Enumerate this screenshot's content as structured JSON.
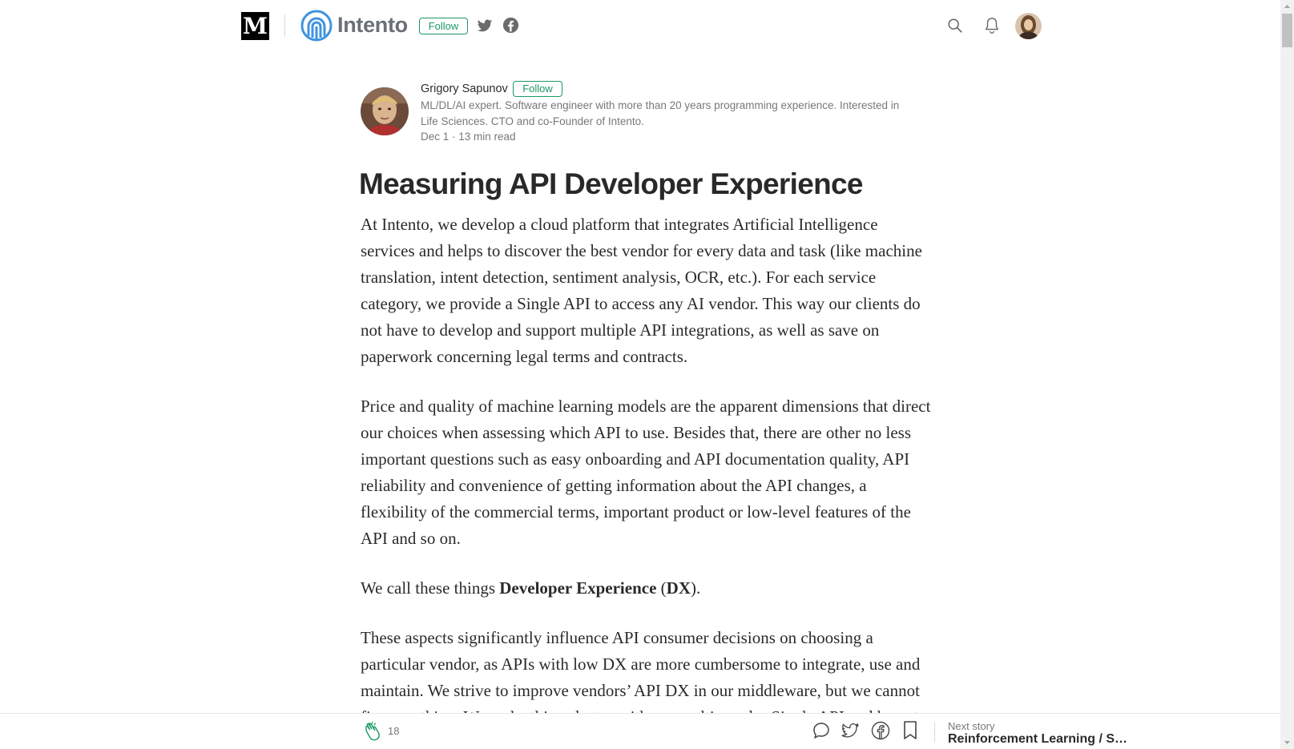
{
  "header": {
    "site_logo": "M",
    "publication_name": "Intento",
    "follow_label": "Follow"
  },
  "author": {
    "name": "Grigory Sapunov",
    "follow_label": "Follow",
    "bio": "ML/DL/AI expert. Software engineer with more than 20 years programming experience. Interested in Life Sciences. CTO and co-Founder of Intento.",
    "meta": "Dec 1 · 13 min read"
  },
  "article": {
    "title": "Measuring API Developer Experience",
    "p1": "At Intento, we develop a cloud platform that integrates Artificial Intelligence services and helps to discover the best vendor for every data and task (like machine translation, intent detection, sentiment analysis, OCR, etc.). For each service category, we provide a Single API to access any AI vendor. This way our clients do not have to develop and support multiple API integrations, as well as save on paperwork concerning legal terms and contracts.",
    "p2": "Price and quality of machine learning models are the apparent dimensions that direct our choices when assessing which API to use. Besides that, there are other no less important questions such as easy onboarding and API documentation quality, API reliability and convenience of getting information about the API changes, a flexibility of the commercial terms, important product or low-level features of the API and so on.",
    "p3_before": "We call these things ",
    "p3_bold1": "Developer Experience",
    "p3_mid": " (",
    "p3_bold2": "DX",
    "p3_after": ").",
    "p4": "These aspects significantly influence API consumer decisions on choosing a particular vendor, as APIs with low DX are more cumbersome to integrate, use and maintain. We strive to improve vendors’ API DX in our middleware, but we cannot fix everything. We make things better with our multi-vendor Single API and hope to provide guidance for vendors."
  },
  "footer": {
    "clap_count": "18",
    "next_label": "Next story",
    "next_title": "Reinforcement Learning / Su..."
  },
  "colors": {
    "accent_green": "#1c9963",
    "text_primary": "rgba(0,0,0,0.84)",
    "text_secondary": "rgba(0,0,0,0.54)"
  }
}
